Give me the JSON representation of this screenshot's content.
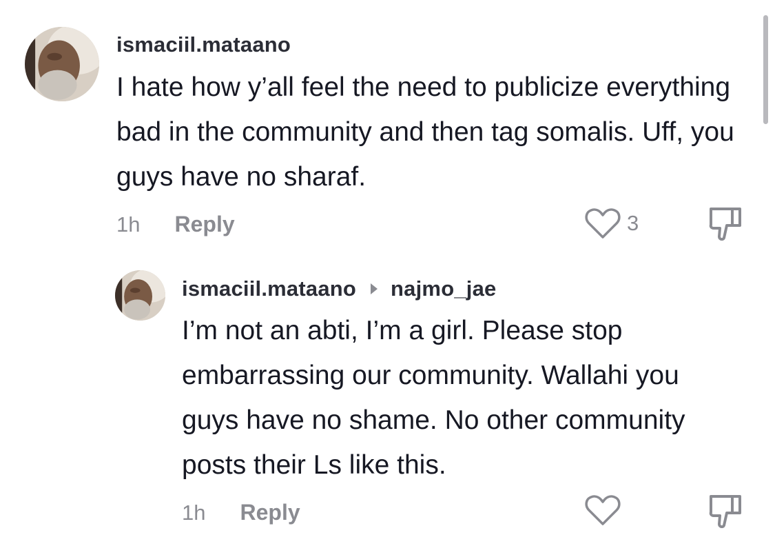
{
  "comments": [
    {
      "username": "ismaciil.mataano",
      "text": "I hate how y’all feel the need to publicize everything bad in the community and then tag somalis. Uff, you guys have no sharaf.",
      "time": "1h",
      "reply_label": "Reply",
      "like_count": "3"
    }
  ],
  "replies": [
    {
      "username": "ismaciil.mataano",
      "reply_to": "najmo_jae",
      "text": "I’m not an abti, I’m a girl. Please stop embarrassing our community. Wallahi you guys have no shame. No other community posts their Ls like this.",
      "time": "1h",
      "reply_label": "Reply"
    }
  ],
  "icons": {
    "like": "heart-outline-icon",
    "dislike": "thumbs-down-outline-icon",
    "reply_arrow": "triangle-right-icon"
  },
  "colors": {
    "text": "#161823",
    "secondary": "#8a8b91",
    "background": "#ffffff"
  }
}
